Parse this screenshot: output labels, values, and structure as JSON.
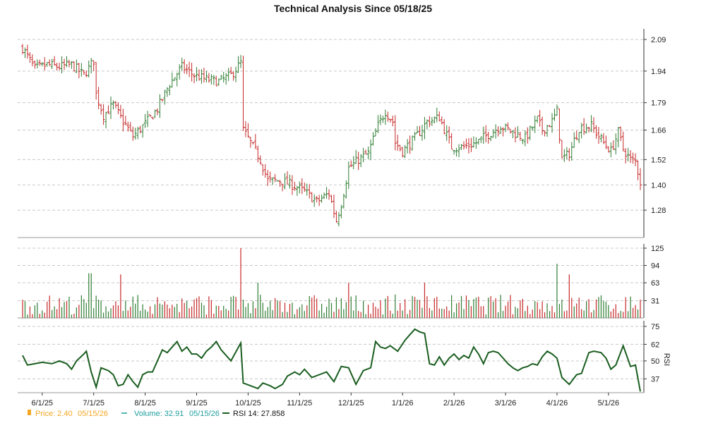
{
  "chart_data": {
    "type": "stock-technical",
    "title": "Technical Analysis Since 05/18/25",
    "x_ticks": [
      "6/1/25",
      "7/1/25",
      "8/1/25",
      "9/1/25",
      "10/1/25",
      "11/1/25",
      "12/1/25",
      "1/1/26",
      "2/1/26",
      "3/1/26",
      "4/1/26",
      "5/1/26"
    ],
    "price_panel": {
      "y_ticks": [
        2.09,
        1.94,
        1.79,
        1.66,
        1.52,
        1.4,
        1.28
      ],
      "ylim": [
        1.15,
        2.12
      ],
      "up_color": "#2e7d32",
      "down_color": "#c62828",
      "keypoints_close": [
        [
          0,
          2.05
        ],
        [
          5,
          1.95
        ],
        [
          10,
          1.97
        ],
        [
          15,
          1.96
        ],
        [
          20,
          1.97
        ],
        [
          25,
          1.92
        ],
        [
          29,
          1.99
        ],
        [
          30,
          1.83
        ],
        [
          33,
          1.73
        ],
        [
          37,
          1.78
        ],
        [
          40,
          1.72
        ],
        [
          45,
          1.63
        ],
        [
          50,
          1.69
        ],
        [
          55,
          1.76
        ],
        [
          60,
          1.88
        ],
        [
          65,
          1.96
        ],
        [
          70,
          1.92
        ],
        [
          75,
          1.9
        ],
        [
          80,
          1.89
        ],
        [
          85,
          1.92
        ],
        [
          89,
          1.98
        ],
        [
          90,
          1.66
        ],
        [
          93,
          1.6
        ],
        [
          97,
          1.52
        ],
        [
          100,
          1.42
        ],
        [
          105,
          1.42
        ],
        [
          110,
          1.4
        ],
        [
          115,
          1.37
        ],
        [
          120,
          1.32
        ],
        [
          125,
          1.36
        ],
        [
          128,
          1.23
        ],
        [
          130,
          1.31
        ],
        [
          133,
          1.48
        ],
        [
          137,
          1.52
        ],
        [
          141,
          1.55
        ],
        [
          145,
          1.68
        ],
        [
          148,
          1.75
        ],
        [
          151,
          1.7
        ],
        [
          152,
          1.6
        ],
        [
          155,
          1.56
        ],
        [
          160,
          1.62
        ],
        [
          165,
          1.7
        ],
        [
          170,
          1.72
        ],
        [
          175,
          1.58
        ],
        [
          180,
          1.58
        ],
        [
          185,
          1.6
        ],
        [
          190,
          1.64
        ],
        [
          195,
          1.68
        ],
        [
          200,
          1.65
        ],
        [
          205,
          1.62
        ],
        [
          210,
          1.71
        ],
        [
          212,
          1.66
        ],
        [
          216,
          1.7
        ],
        [
          218,
          1.75
        ],
        [
          220,
          1.52
        ],
        [
          223,
          1.55
        ],
        [
          227,
          1.67
        ],
        [
          232,
          1.68
        ],
        [
          237,
          1.6
        ],
        [
          240,
          1.56
        ],
        [
          243,
          1.65
        ],
        [
          245,
          1.57
        ],
        [
          248,
          1.52
        ],
        [
          250,
          1.51
        ],
        [
          252,
          1.42
        ]
      ],
      "last_close": 1.4
    },
    "volume_panel": {
      "y_ticks": [
        125,
        94,
        63,
        31
      ],
      "ylim": [
        0,
        125
      ],
      "spikes": [
        [
          27,
          80
        ],
        [
          28,
          80
        ],
        [
          40,
          78
        ],
        [
          89,
          125
        ],
        [
          96,
          63
        ],
        [
          133,
          63
        ],
        [
          164,
          63
        ],
        [
          218,
          97
        ],
        [
          223,
          78
        ]
      ]
    },
    "rsi_panel": {
      "y_label": "RSI",
      "y_ticks": [
        75,
        62,
        50,
        37
      ],
      "ylim": [
        27,
        76
      ],
      "color": "#1b5e20",
      "keypoints": [
        [
          0,
          54
        ],
        [
          2,
          47
        ],
        [
          5,
          48
        ],
        [
          8,
          49
        ],
        [
          12,
          48
        ],
        [
          15,
          50
        ],
        [
          18,
          48
        ],
        [
          20,
          44
        ],
        [
          22,
          50
        ],
        [
          25,
          55
        ],
        [
          26,
          57
        ],
        [
          28,
          42
        ],
        [
          30,
          31
        ],
        [
          32,
          45
        ],
        [
          35,
          43
        ],
        [
          37,
          40
        ],
        [
          39,
          32
        ],
        [
          41,
          33
        ],
        [
          43,
          40
        ],
        [
          45,
          35
        ],
        [
          47,
          31
        ],
        [
          49,
          40
        ],
        [
          51,
          42
        ],
        [
          53,
          42
        ],
        [
          55,
          50
        ],
        [
          57,
          58
        ],
        [
          59,
          56
        ],
        [
          61,
          60
        ],
        [
          63,
          64
        ],
        [
          65,
          57
        ],
        [
          67,
          60
        ],
        [
          69,
          55
        ],
        [
          71,
          55
        ],
        [
          73,
          52
        ],
        [
          75,
          57
        ],
        [
          77,
          60
        ],
        [
          79,
          64
        ],
        [
          81,
          58
        ],
        [
          85,
          50
        ],
        [
          89,
          63
        ],
        [
          90,
          34
        ],
        [
          93,
          32
        ],
        [
          96,
          30
        ],
        [
          98,
          34
        ],
        [
          101,
          32
        ],
        [
          103,
          30
        ],
        [
          106,
          33
        ],
        [
          108,
          39
        ],
        [
          111,
          42
        ],
        [
          113,
          40
        ],
        [
          115,
          44
        ],
        [
          118,
          38
        ],
        [
          121,
          40
        ],
        [
          124,
          42
        ],
        [
          127,
          35
        ],
        [
          130,
          46
        ],
        [
          133,
          45
        ],
        [
          136,
          33
        ],
        [
          139,
          43
        ],
        [
          142,
          45
        ],
        [
          144,
          64
        ],
        [
          146,
          60
        ],
        [
          148,
          59
        ],
        [
          150,
          61
        ],
        [
          153,
          57
        ],
        [
          156,
          65
        ],
        [
          158,
          69
        ],
        [
          160,
          73
        ],
        [
          162,
          71
        ],
        [
          164,
          70
        ],
        [
          166,
          48
        ],
        [
          168,
          47
        ],
        [
          170,
          53
        ],
        [
          172,
          47
        ],
        [
          174,
          52
        ],
        [
          176,
          55
        ],
        [
          178,
          51
        ],
        [
          180,
          54
        ],
        [
          182,
          52
        ],
        [
          184,
          60
        ],
        [
          186,
          55
        ],
        [
          188,
          48
        ],
        [
          190,
          56
        ],
        [
          192,
          57
        ],
        [
          194,
          56
        ],
        [
          196,
          52
        ],
        [
          198,
          48
        ],
        [
          200,
          45
        ],
        [
          202,
          43
        ],
        [
          204,
          45
        ],
        [
          206,
          46
        ],
        [
          208,
          48
        ],
        [
          210,
          47
        ],
        [
          212,
          53
        ],
        [
          214,
          57
        ],
        [
          216,
          55
        ],
        [
          218,
          52
        ],
        [
          220,
          38
        ],
        [
          223,
          33
        ],
        [
          226,
          40
        ],
        [
          228,
          41
        ],
        [
          231,
          56
        ],
        [
          233,
          57
        ],
        [
          236,
          56
        ],
        [
          238,
          52
        ],
        [
          240,
          44
        ],
        [
          242,
          47
        ],
        [
          245,
          61
        ],
        [
          248,
          46
        ],
        [
          250,
          47
        ],
        [
          252,
          27.86
        ]
      ]
    }
  },
  "legend": {
    "price_label": "Price: 2.40",
    "price_date": "05/15/26",
    "price_color": "#f5a623",
    "volume_label": "Volume: 32.91",
    "volume_date": "05/15/26",
    "volume_color": "#1f9e9e",
    "rsi_label": "RSI 14: 27.858",
    "rsi_color": "#1b5e20"
  }
}
